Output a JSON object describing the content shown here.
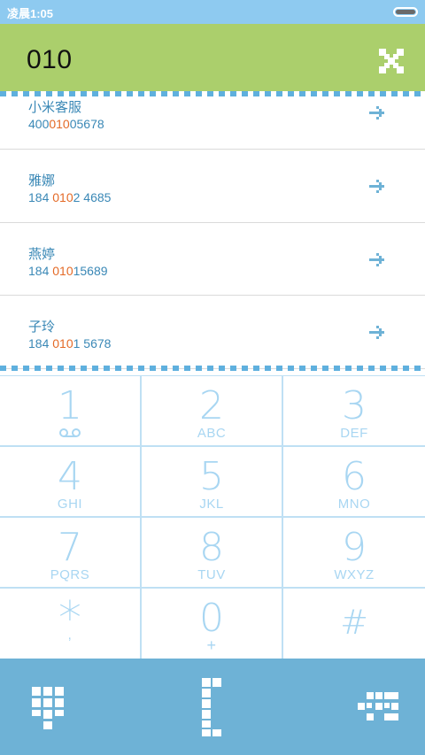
{
  "status_bar": {
    "time": "凌晨1:05"
  },
  "header": {
    "dialed_number": "010"
  },
  "contacts": [
    {
      "name": "小米客服",
      "number_pre": "400",
      "number_match": "010",
      "number_post": "05678"
    },
    {
      "name": "雅娜",
      "number_pre": "184 ",
      "number_match": "010",
      "number_post": "2 4685"
    },
    {
      "name": "燕婷",
      "number_pre": "184 ",
      "number_match": "010",
      "number_post": "15689"
    },
    {
      "name": "子玲",
      "number_pre": "184 ",
      "number_match": "010",
      "number_post": "1 5678"
    }
  ],
  "keypad": [
    {
      "digit": "1",
      "letters": ""
    },
    {
      "digit": "2",
      "letters": "ABC"
    },
    {
      "digit": "3",
      "letters": "DEF"
    },
    {
      "digit": "4",
      "letters": "GHI"
    },
    {
      "digit": "5",
      "letters": "JKL"
    },
    {
      "digit": "6",
      "letters": "MNO"
    },
    {
      "digit": "7",
      "letters": "PQRS"
    },
    {
      "digit": "8",
      "letters": "TUV"
    },
    {
      "digit": "9",
      "letters": "WXYZ"
    },
    {
      "digit": "*",
      "letters": ","
    },
    {
      "digit": "0",
      "letters": "+"
    },
    {
      "digit": "#",
      "letters": ""
    }
  ],
  "icons": {
    "close": "close-icon",
    "arrow": "call-arrow-icon",
    "voicemail": "voicemail-icon",
    "hide_keypad": "keypad-toggle-icon",
    "call": "phone-call-icon",
    "delete": "backspace-icon"
  },
  "colors": {
    "status_bar": "#8ecaf0",
    "header": "#abcf6c",
    "accent_blue": "#3a88b6",
    "match_orange": "#e46a27",
    "keypad_text": "#a8d6f2",
    "bottom_bar": "#6eb2d6"
  }
}
